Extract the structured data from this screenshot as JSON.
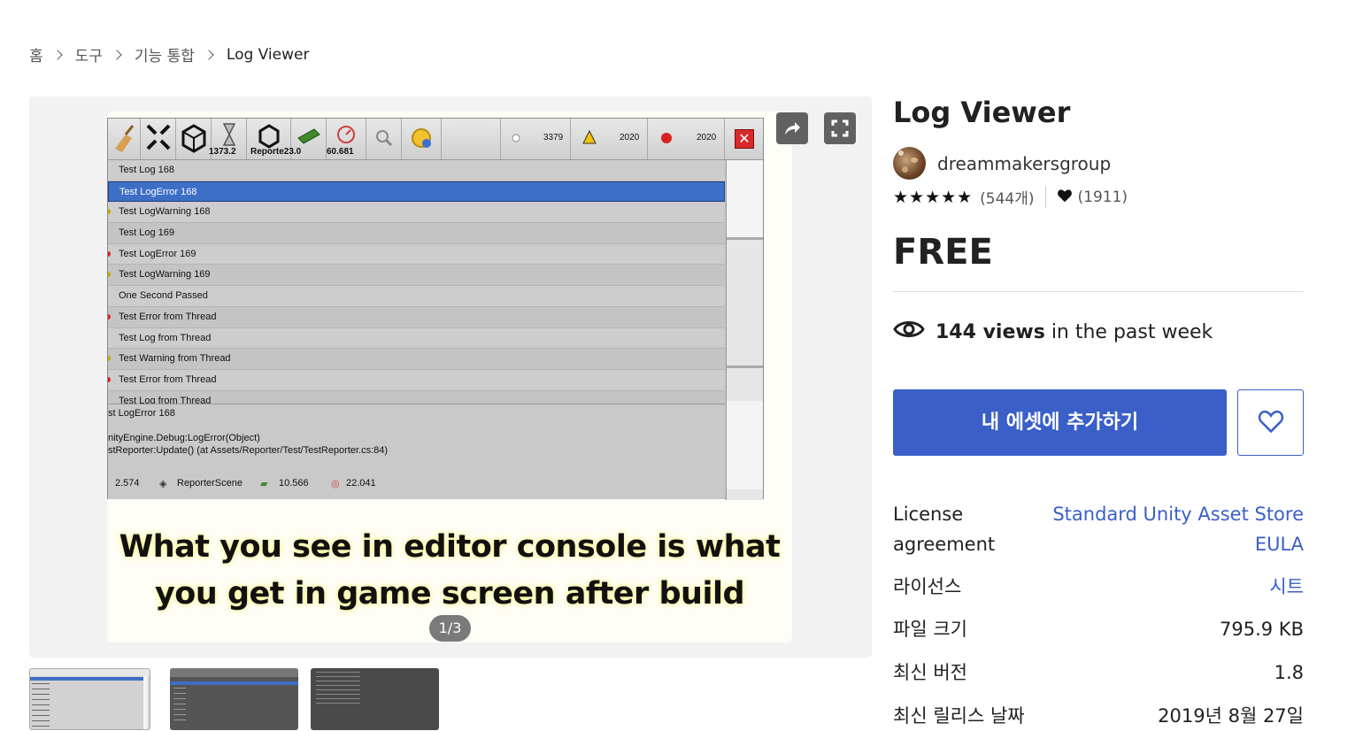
{
  "breadcrumb": [
    "홈",
    "도구",
    "기능 통합",
    "Log Viewer"
  ],
  "gallery": {
    "counter": "1/3",
    "caption_line1": "What you see in editor console is what",
    "caption_line2": "you get in game screen after build",
    "toolbar": {
      "fps": "1373.2",
      "scene": "Reporte23.0",
      "mem": "60.681",
      "log_count": "3379",
      "warn_count": "2020",
      "error_count": "2020",
      "close": "✕"
    },
    "log_rows": [
      {
        "text": "Test Log 168",
        "type": "log"
      },
      {
        "text": "Test LogError 168",
        "type": "selected"
      },
      {
        "text": "Test LogWarning 168",
        "type": "warn"
      },
      {
        "text": "Test Log 169",
        "type": "log"
      },
      {
        "text": "Test LogError 169",
        "type": "error"
      },
      {
        "text": "Test LogWarning 169",
        "type": "warn"
      },
      {
        "text": "One Second Passed",
        "type": "log"
      },
      {
        "text": "Test Error from Thread",
        "type": "error"
      },
      {
        "text": "Test Log from Thread",
        "type": "log"
      },
      {
        "text": "Test Warning from Thread",
        "type": "warn"
      },
      {
        "text": "Test Error from Thread",
        "type": "error"
      },
      {
        "text": "Test Log from Thread",
        "type": "log"
      }
    ],
    "detail_lines": [
      "st LogError 168",
      "nityEngine.Debug:LogError(Object)",
      "stReporter:Update() (at Assets/Reporter/Test/TestReporter.cs:84)"
    ],
    "footer": {
      "fps": "2.574",
      "scene": "ReporterScene",
      "mem": "10.566",
      "gc": "22.041"
    }
  },
  "product": {
    "title": "Log Viewer",
    "publisher": "dreammakersgroup",
    "stars": "★★★★★",
    "review_count": "(544개)",
    "favorite_count": "(1911)",
    "price": "FREE",
    "views_count": "144 views",
    "views_suffix": "in the past week",
    "add_button": "내 에셋에 추가하기"
  },
  "specs": [
    {
      "label_line1": "License",
      "label_line2": "agreement",
      "value_line1": "Standard Unity Asset Store",
      "value_line2": "EULA",
      "link": true
    },
    {
      "label": "라이선스",
      "value": "시트",
      "link": true
    },
    {
      "label": "파일 크기",
      "value": "795.9 KB"
    },
    {
      "label": "최신 버전",
      "value": "1.8"
    },
    {
      "label": "최신 릴리스 날짜",
      "value": "2019년 8월 27일"
    }
  ],
  "colors": {
    "accent": "#3a5fc8",
    "gallery_bg": "#f2f2f2"
  },
  "icons": [
    "chevron-right-icon",
    "share-icon",
    "fullscreen-icon",
    "eye-icon",
    "heart-outline-icon",
    "heart-icon",
    "star-icon"
  ]
}
